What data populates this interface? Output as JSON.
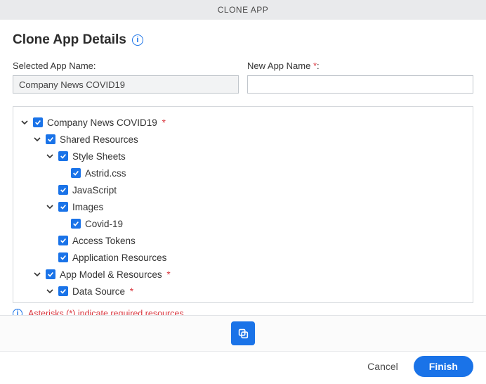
{
  "header": {
    "title": "CLONE APP"
  },
  "page": {
    "title": "Clone App Details"
  },
  "form": {
    "selected_label": "Selected App Name:",
    "selected_value": "Company News COVID19",
    "new_label": "New App Name ",
    "new_value": "",
    "new_placeholder": ""
  },
  "tree": {
    "root": {
      "label": "Company News COVID19",
      "required": true,
      "children": [
        {
          "label": "Shared Resources",
          "children": [
            {
              "label": "Style Sheets",
              "children": [
                {
                  "label": "Astrid.css"
                }
              ]
            },
            {
              "label": "JavaScript"
            },
            {
              "label": "Images",
              "children": [
                {
                  "label": "Covid-19"
                }
              ]
            },
            {
              "label": "Access Tokens"
            },
            {
              "label": "Application Resources"
            }
          ]
        },
        {
          "label": "App Model & Resources",
          "required": true,
          "children": [
            {
              "label": "Data Source",
              "required": true
            }
          ]
        }
      ]
    }
  },
  "note": "Asterisks (*) indicate required resources.",
  "buttons": {
    "cancel": "Cancel",
    "finish": "Finish"
  }
}
